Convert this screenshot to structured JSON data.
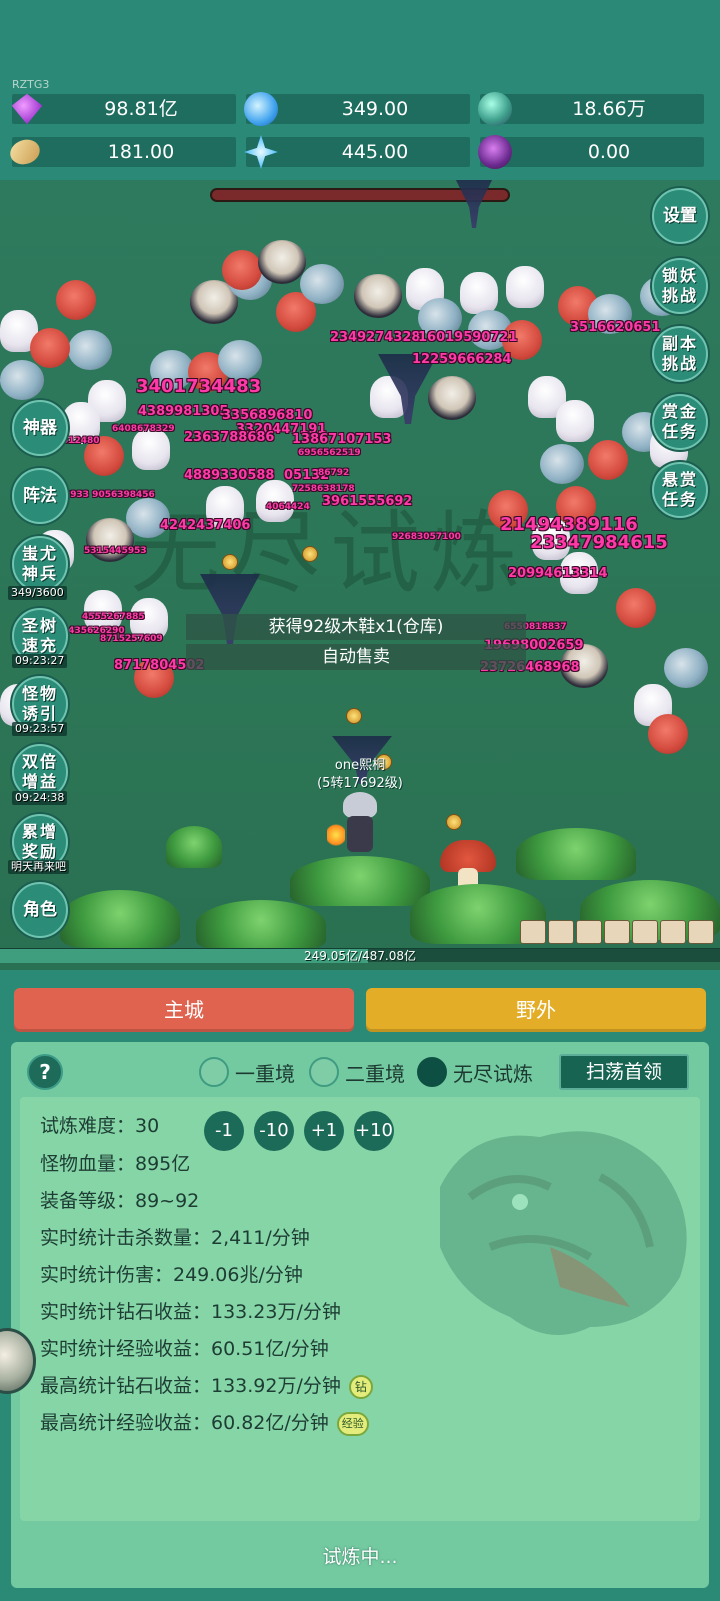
{
  "header": {
    "tag": "RZTG3",
    "resources": [
      {
        "icon": "gem-icon",
        "value": "98.81亿"
      },
      {
        "icon": "crystal-icon",
        "value": "349.00"
      },
      {
        "icon": "orb-icon",
        "value": "18.66万"
      },
      {
        "icon": "scroll-icon",
        "value": "181.00"
      },
      {
        "icon": "shard-icon",
        "value": "445.00"
      },
      {
        "icon": "potion-icon",
        "value": "0.00"
      }
    ]
  },
  "battle": {
    "watermark": "无尽试炼",
    "damage_numbers": [
      "2349274328",
      "16019590721",
      "3516620651",
      "12259666284",
      "3401734483",
      "4389981305",
      "3356896810",
      "6408678329",
      "3320447191",
      "2363788686",
      "13867107153",
      "6956562519",
      "4889330588",
      "05132",
      "86792",
      "7258638178",
      "3961555692",
      "4064424",
      "4242437406",
      "8933 9056398456",
      "92683057100",
      "21494389116",
      "23347984615",
      "20994613314",
      "5315445953",
      "4555267885",
      "2435626290",
      "8715257609",
      "8717804502",
      "6550818837",
      "19698002659",
      "23726468968",
      "612480"
    ],
    "messages": [
      "获得92级木鞋x1(仓库)",
      "自动售卖"
    ],
    "player_name": "one熙桐",
    "player_level": "(5转17692级)",
    "xp_text": "249.05亿/487.08亿",
    "xp_progress": 0.511
  },
  "left_buttons": [
    {
      "label": "神器"
    },
    {
      "label": "阵法"
    },
    {
      "label": "蚩尤神兵",
      "sub": "349/3600"
    },
    {
      "label": "圣树速充",
      "sub": "09:23:27"
    },
    {
      "label": "怪物诱引",
      "sub": "09:23:57"
    },
    {
      "label": "双倍增益",
      "sub": "09:24:38"
    },
    {
      "label": "累增奖励",
      "sub": "明天再来吧"
    },
    {
      "label": "角色"
    }
  ],
  "right_buttons": [
    {
      "label": "设置"
    },
    {
      "label": "锁妖挑战"
    },
    {
      "label": "副本挑战"
    },
    {
      "label": "赏金任务"
    },
    {
      "label": "悬赏任务"
    }
  ],
  "tabs": {
    "main_city": "主城",
    "wild": "野外",
    "main_city_color": "#e0634f",
    "wild_color": "#e3ad27"
  },
  "panel": {
    "help": "?",
    "modes": [
      "一重境",
      "二重境",
      "无尽试炼"
    ],
    "selected_mode": "无尽试炼",
    "sweep": "扫荡首领",
    "difficulty_label": "试炼难度：",
    "difficulty_value": "30",
    "steps": [
      "-1",
      "-10",
      "+1",
      "+10"
    ],
    "stats": [
      "怪物血量：895亿",
      "装备等级：89~92",
      "实时统计击杀数量：2,411/分钟",
      "实时统计伤害：249.06兆/分钟",
      "实时统计钻石收益：133.23万/分钟",
      "实时统计经验收益：60.51亿/分钟",
      "最高统计钻石收益：133.92万/分钟",
      "最高统计经验收益：60.82亿/分钟"
    ],
    "badge_diamond": "钻",
    "badge_exp": "经验",
    "status": "试炼中..."
  }
}
